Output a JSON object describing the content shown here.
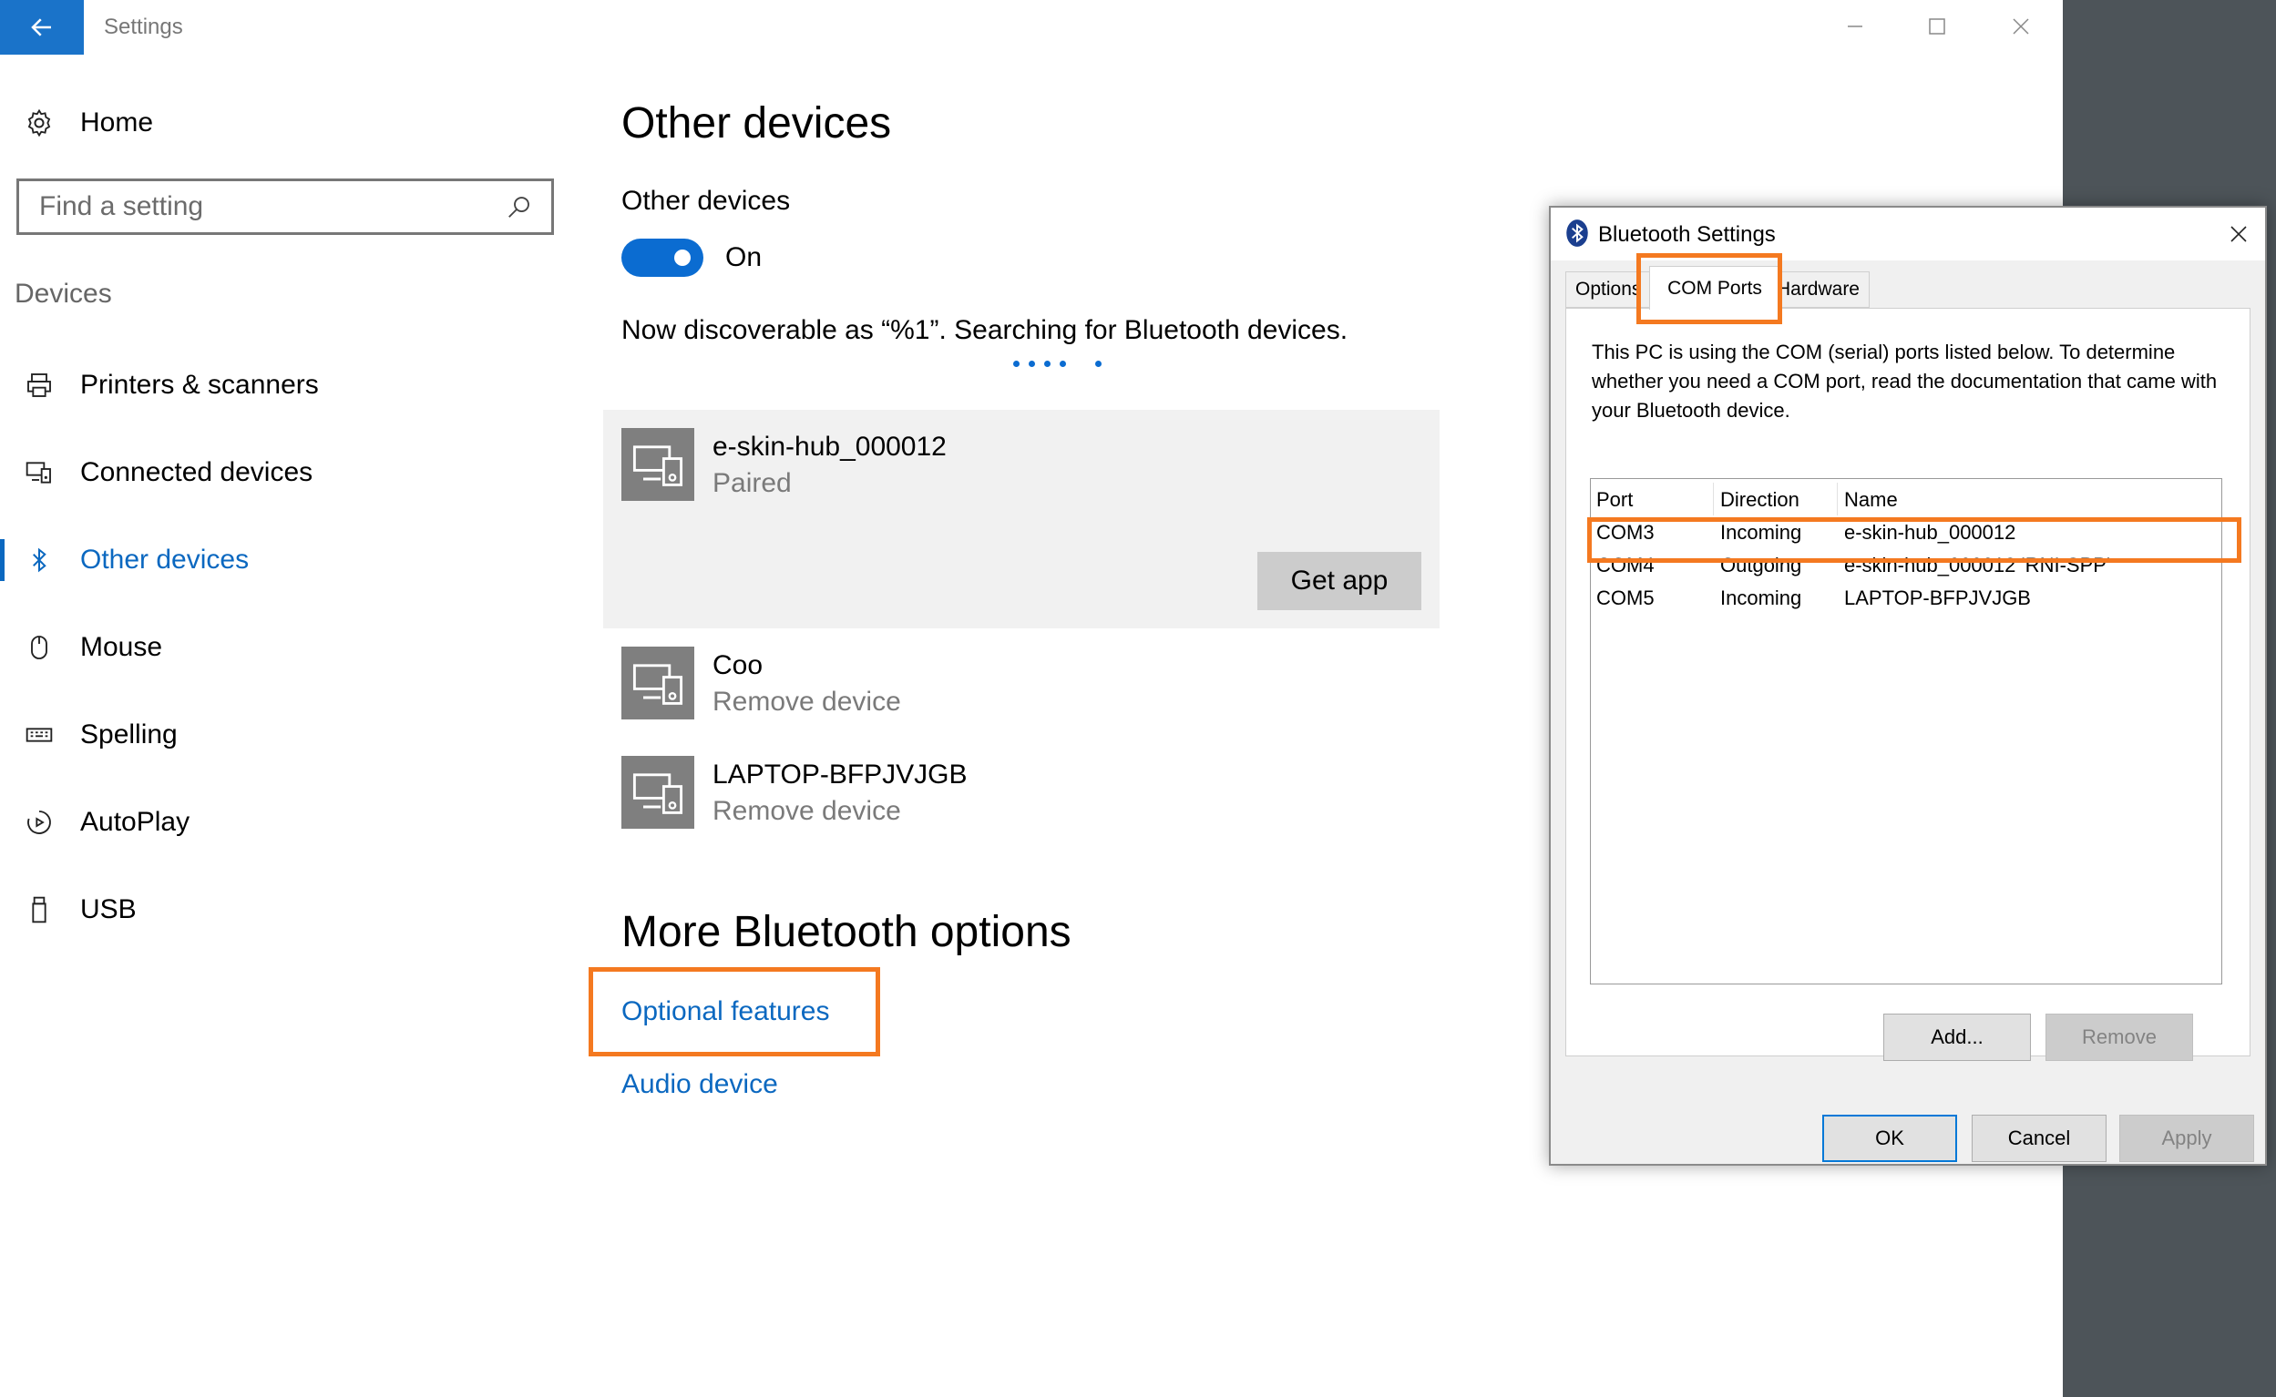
{
  "window": {
    "title": "Settings"
  },
  "sidebar": {
    "home_label": "Home",
    "search_placeholder": "Find a setting",
    "section_label": "Devices",
    "items": [
      {
        "label": "Printers & scanners",
        "icon": "printer-icon"
      },
      {
        "label": "Connected devices",
        "icon": "connected-devices-icon"
      },
      {
        "label": "Other devices",
        "icon": "bluetooth-icon",
        "active": true
      },
      {
        "label": "Mouse",
        "icon": "mouse-icon"
      },
      {
        "label": "Spelling",
        "icon": "keyboard-icon"
      },
      {
        "label": "AutoPlay",
        "icon": "autoplay-icon"
      },
      {
        "label": "USB",
        "icon": "usb-icon"
      }
    ]
  },
  "main": {
    "title": "Other devices",
    "toggle_label": "Other devices",
    "toggle_state": "On",
    "discoverable_text": "Now discoverable as “%1”. Searching for Bluetooth devices.",
    "devices": [
      {
        "name": "e-skin-hub_000012",
        "status": "Paired",
        "action": "Get app"
      },
      {
        "name": "Coo",
        "status": "Remove device"
      },
      {
        "name": "LAPTOP-BFPJVJGB",
        "status": "Remove device"
      }
    ],
    "more_title": "More Bluetooth options",
    "links": [
      "Optional features",
      "Audio device"
    ]
  },
  "dialog": {
    "title": "Bluetooth Settings",
    "tabs": [
      "Options",
      "COM Ports",
      "Hardware"
    ],
    "description": "This PC is using the COM (serial) ports listed below. To determine whether you need a COM port, read the documentation that came with your Bluetooth device.",
    "columns": [
      "Port",
      "Direction",
      "Name"
    ],
    "rows": [
      {
        "port": "COM3",
        "direction": "Incoming",
        "name": "e-skin-hub_000012"
      },
      {
        "port": "COM4",
        "direction": "Outgoing",
        "name": "e-skin-hub_000012 'RNI-SPP'"
      },
      {
        "port": "COM5",
        "direction": "Incoming",
        "name": "LAPTOP-BFPJVJGB"
      }
    ],
    "add_label": "Add...",
    "remove_label": "Remove",
    "ok_label": "OK",
    "cancel_label": "Cancel",
    "apply_label": "Apply"
  },
  "colors": {
    "accent": "#0b68c0",
    "highlight": "#f47920",
    "toggle_on": "#0b6cd1"
  }
}
